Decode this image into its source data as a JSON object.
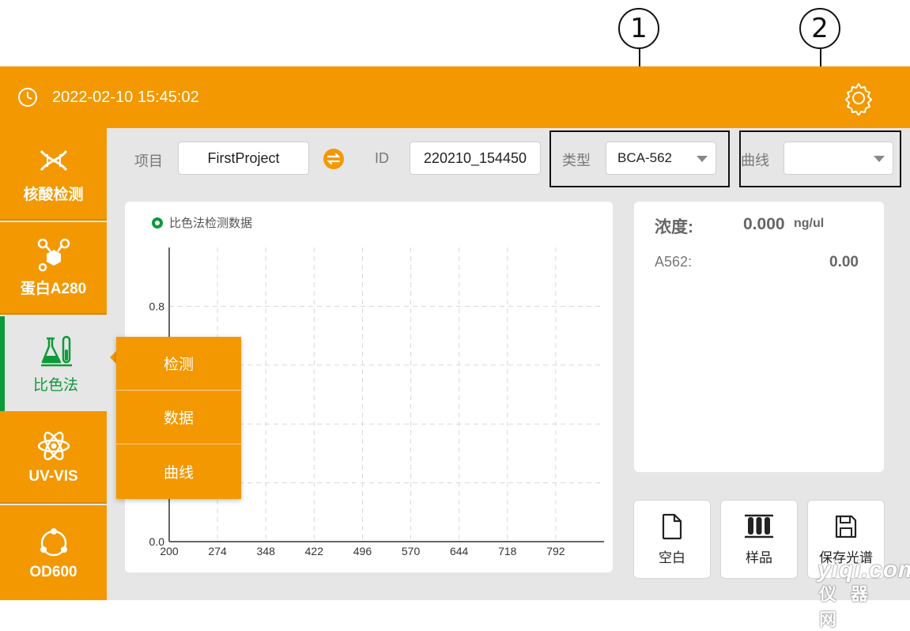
{
  "callouts": [
    {
      "label": "1"
    },
    {
      "label": "2"
    }
  ],
  "header": {
    "datetime": "2022-02-10 15:45:02"
  },
  "sidebar": {
    "items": [
      {
        "label": "核酸检测",
        "icon": "dna-icon"
      },
      {
        "label": "蛋白A280",
        "icon": "molecule-icon"
      },
      {
        "label": "比色法",
        "icon": "flask-icon",
        "active": true
      },
      {
        "label": "UV-VIS",
        "icon": "atom-icon"
      },
      {
        "label": "OD600",
        "icon": "cell-icon"
      }
    ]
  },
  "toolbar": {
    "project_label": "项目",
    "project_value": "FirstProject",
    "id_label": "ID",
    "id_value": "220210_154450",
    "type_label": "类型",
    "type_value": "BCA-562",
    "curve_label": "曲线",
    "curve_value": ""
  },
  "chart_data": {
    "type": "line",
    "title": "比色法检测数据",
    "x": [
      200,
      274,
      348,
      422,
      496,
      570,
      644,
      718,
      792
    ],
    "x_tick_labels": [
      "200",
      "274",
      "348",
      "422",
      "496",
      "570",
      "644",
      "718",
      "792"
    ],
    "y_tick_labels": [
      "0.8",
      "0.0"
    ],
    "ylim": [
      0.0,
      1.0
    ],
    "xlim": [
      200,
      866
    ],
    "grid": true,
    "series": []
  },
  "popup_menu": {
    "items": [
      "检测",
      "数据",
      "曲线"
    ]
  },
  "result": {
    "concentration_label": "浓度:",
    "concentration_value": "0.000",
    "concentration_unit": "ng/ul",
    "absorbance_label": "A562:",
    "absorbance_value": "0.00"
  },
  "actions": [
    {
      "label": "空白",
      "icon": "file-icon"
    },
    {
      "label": "样品",
      "icon": "test-tubes-icon"
    },
    {
      "label": "保存光谱",
      "icon": "save-icon"
    }
  ],
  "watermark": {
    "line1": "yiqi.com",
    "line2": "仪器网"
  },
  "colors": {
    "accent": "#f39800",
    "active": "#0d9a3a",
    "background": "#e6e6e6"
  }
}
